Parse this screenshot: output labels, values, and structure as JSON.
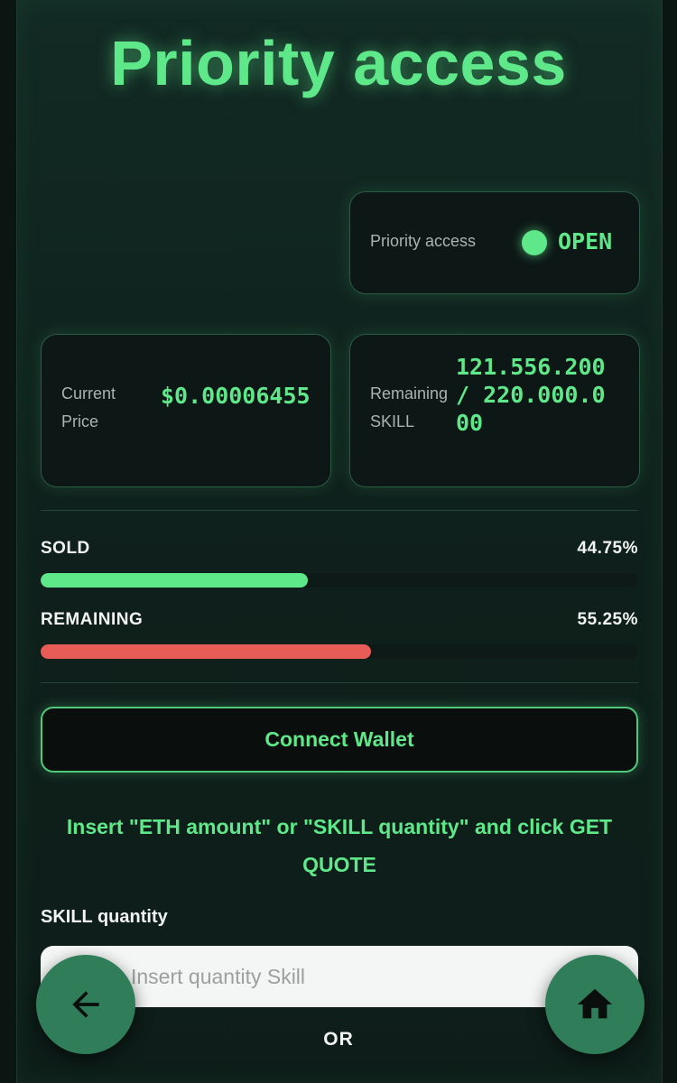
{
  "title": "Priority access",
  "status": {
    "label": "Priority access",
    "value": "OPEN",
    "color": "#5ee88a"
  },
  "price": {
    "label": "Current Price",
    "value": "$0.00006455"
  },
  "remaining": {
    "label": "Remaining SKILL",
    "value": "121.556.200 / 220.000.000"
  },
  "progress": {
    "sold": {
      "label": "SOLD",
      "percent_text": "44.75%",
      "fraction": 0.4475,
      "color": "#5ee88a"
    },
    "remaining": {
      "label": "REMAINING",
      "percent_text": "55.25%",
      "fraction": 0.5525,
      "color": "#e85c58"
    }
  },
  "connect_button": {
    "label": "Connect Wallet"
  },
  "instruction": "Insert \"ETH amount\" or \"SKILL quantity\" and click GET QUOTE",
  "quantity": {
    "label": "SKILL quantity",
    "placeholder": "Insert quantity Skill",
    "value": ""
  },
  "or_text": "OR",
  "nav": {
    "back_icon": "arrow-left-icon",
    "home_icon": "home-icon"
  }
}
